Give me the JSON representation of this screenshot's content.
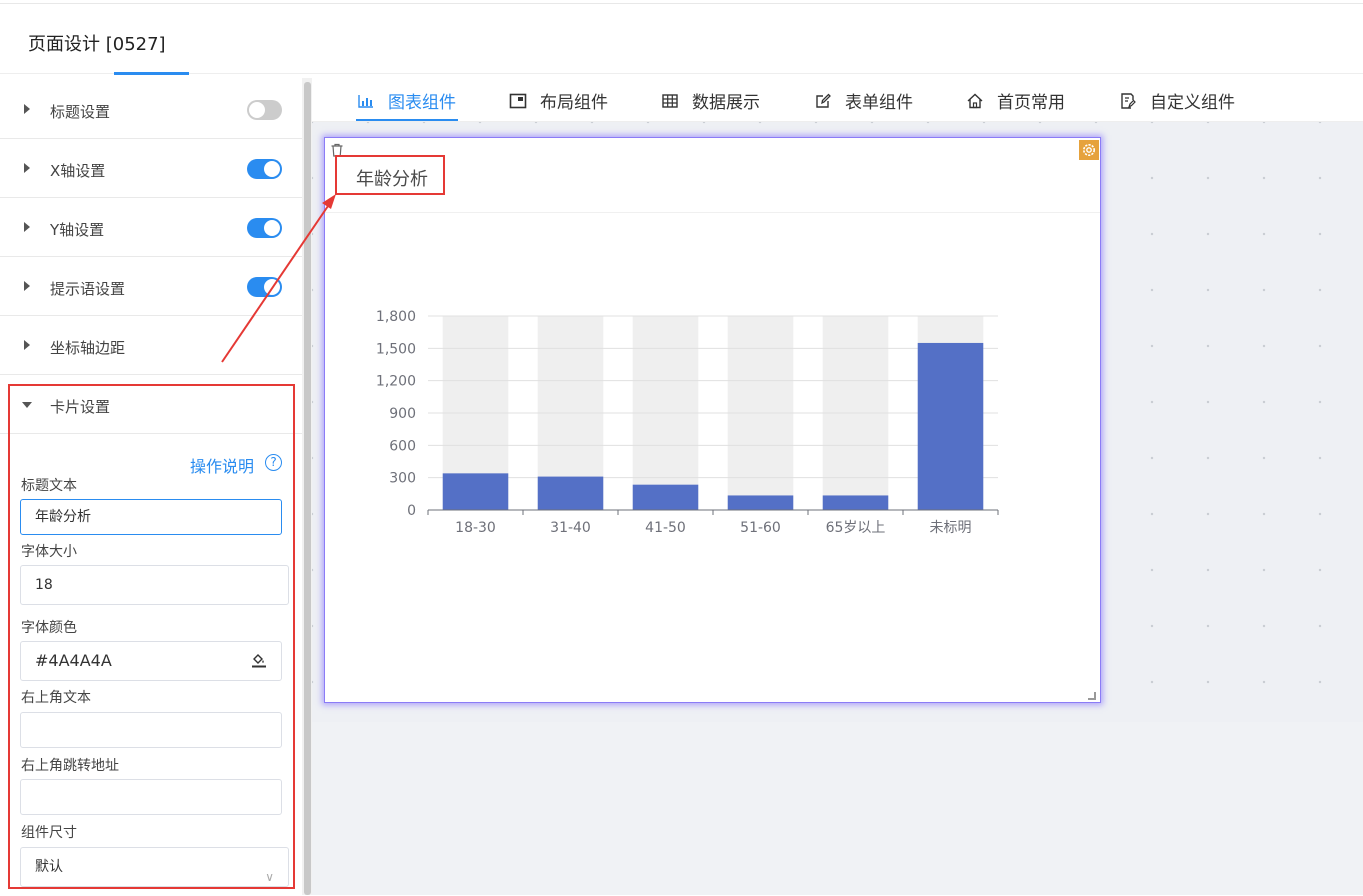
{
  "header": {
    "title": "页面设计 [0527]"
  },
  "settings": {
    "sections": [
      {
        "label": "标题设置",
        "toggle": "off"
      },
      {
        "label": "X轴设置",
        "toggle": "on"
      },
      {
        "label": "Y轴设置",
        "toggle": "on"
      },
      {
        "label": "提示语设置",
        "toggle": "on"
      },
      {
        "label": "坐标轴边距"
      },
      {
        "label": "卡片设置",
        "expanded": true
      }
    ],
    "card": {
      "help_link": "操作说明",
      "title_text_label": "标题文本",
      "title_text_value": "年龄分析",
      "font_size_label": "字体大小",
      "font_size_value": "18",
      "font_color_label": "字体颜色",
      "font_color_value": "#4A4A4A",
      "corner_text_label": "右上角文本",
      "corner_text_value": "",
      "corner_link_label": "右上角跳转地址",
      "corner_link_value": "",
      "size_label": "组件尺寸",
      "size_value": "默认"
    }
  },
  "tabs": [
    {
      "label": "图表组件",
      "icon": "bar-chart-icon",
      "active": true
    },
    {
      "label": "布局组件",
      "icon": "layout-icon"
    },
    {
      "label": "数据展示",
      "icon": "grid-table-icon"
    },
    {
      "label": "表单组件",
      "icon": "edit-form-icon"
    },
    {
      "label": "首页常用",
      "icon": "home-icon"
    },
    {
      "label": "自定义组件",
      "icon": "custom-doc-icon"
    }
  ],
  "colors": {
    "accent": "#2a8cf0",
    "bar": "#5470c6",
    "bar_background": "#efefef",
    "highlight": "#e53935",
    "selection": "#8b7cf6"
  },
  "chart_card": {
    "title": "年龄分析"
  },
  "chart_data": {
    "type": "bar",
    "title": "年龄分析",
    "categories": [
      "18-30",
      "31-40",
      "41-50",
      "51-60",
      "65岁以上",
      "未标明"
    ],
    "values": [
      340,
      310,
      235,
      135,
      135,
      1550
    ],
    "background_bar": true,
    "ylim": [
      0,
      1800
    ],
    "yticks": [
      0,
      300,
      600,
      900,
      1200,
      1500,
      1800
    ],
    "ytick_labels": [
      "0",
      "300",
      "600",
      "900",
      "1,200",
      "1,500",
      "1,800"
    ],
    "grid": true,
    "xlabel": "",
    "ylabel": ""
  }
}
